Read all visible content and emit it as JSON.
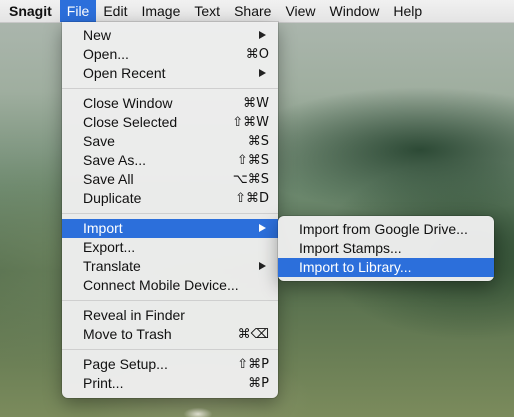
{
  "menubar": {
    "items": [
      "Snagit",
      "File",
      "Edit",
      "Image",
      "Text",
      "Share",
      "View",
      "Window",
      "Help"
    ]
  },
  "file_menu": {
    "group1": [
      {
        "label": "New",
        "shortcut": "",
        "submenu": true
      },
      {
        "label": "Open...",
        "shortcut": "⌘O"
      },
      {
        "label": "Open Recent",
        "shortcut": "",
        "submenu": true
      }
    ],
    "group2": [
      {
        "label": "Close Window",
        "shortcut": "⌘W"
      },
      {
        "label": "Close Selected",
        "shortcut": "⇧⌘W"
      },
      {
        "label": "Save",
        "shortcut": "⌘S"
      },
      {
        "label": "Save As...",
        "shortcut": "⇧⌘S"
      },
      {
        "label": "Save All",
        "shortcut": "⌥⌘S"
      },
      {
        "label": "Duplicate",
        "shortcut": "⇧⌘D"
      }
    ],
    "group3": [
      {
        "label": "Import",
        "submenu": true,
        "highlighted": true
      },
      {
        "label": "Export...",
        "shortcut": ""
      },
      {
        "label": "Translate",
        "submenu": true
      },
      {
        "label": "Connect Mobile Device...",
        "shortcut": ""
      }
    ],
    "group4": [
      {
        "label": "Reveal in Finder",
        "shortcut": ""
      },
      {
        "label": "Move to Trash",
        "shortcut": "⌘⌫"
      }
    ],
    "group5": [
      {
        "label": "Page Setup...",
        "shortcut": "⇧⌘P"
      },
      {
        "label": "Print...",
        "shortcut": "⌘P"
      }
    ]
  },
  "import_submenu": {
    "items": [
      {
        "label": "Import from Google Drive..."
      },
      {
        "label": "Import Stamps..."
      },
      {
        "label": "Import to Library...",
        "highlighted": true
      }
    ]
  }
}
